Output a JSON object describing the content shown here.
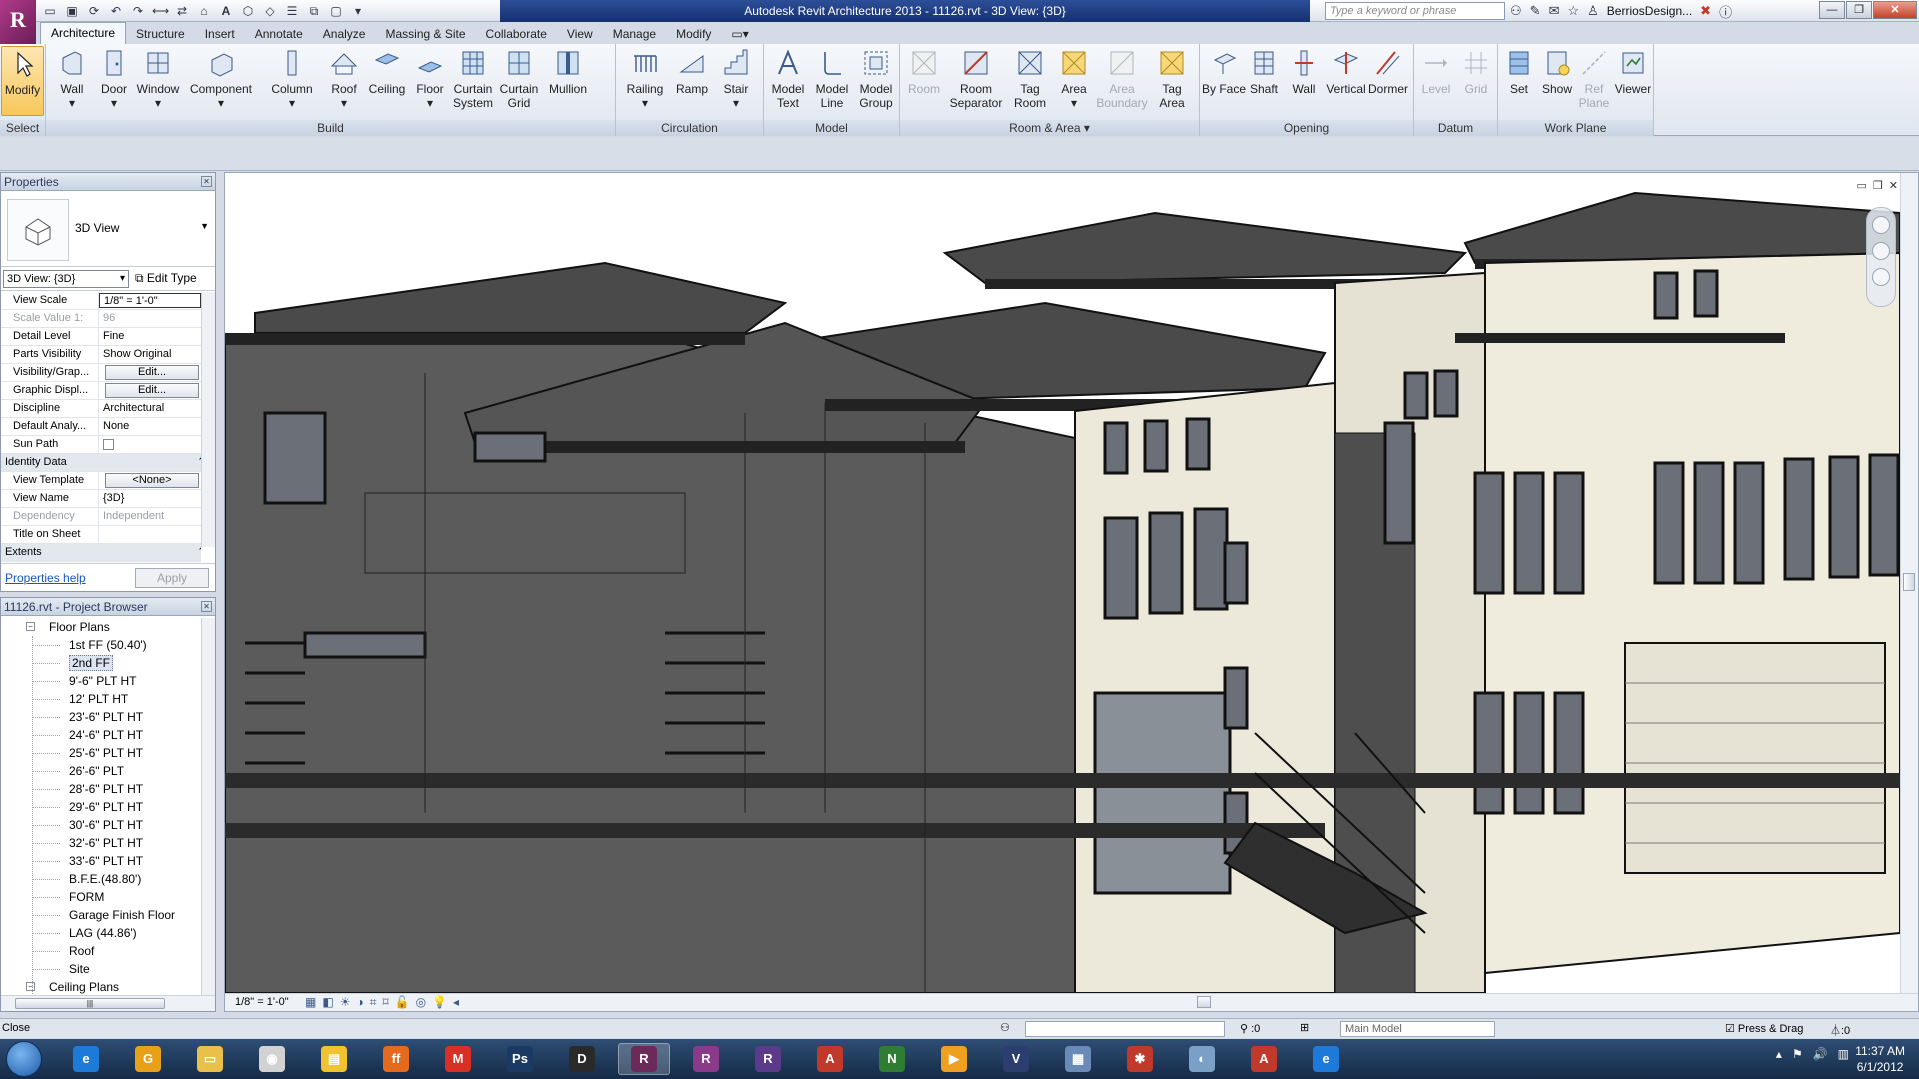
{
  "title_bar": {
    "title": "Autodesk Revit Architecture 2013  -  11126.rvt - 3D View: {3D}",
    "search_placeholder": "Type a keyword or phrase",
    "user": "BerriosDesign..."
  },
  "ribbon": {
    "tabs": [
      "Architecture",
      "Structure",
      "Insert",
      "Annotate",
      "Analyze",
      "Massing & Site",
      "Collaborate",
      "View",
      "Manage",
      "Modify"
    ],
    "groups": {
      "select": "Select",
      "build": "Build",
      "circulation": "Circulation",
      "model": "Model",
      "room_area": "Room & Area",
      "opening": "Opening",
      "datum": "Datum",
      "work_plane": "Work Plane"
    },
    "buttons": {
      "modify": "Modify",
      "wall": "Wall",
      "door": "Door",
      "window": "Window",
      "component": "Component",
      "column": "Column",
      "roof": "Roof",
      "ceiling": "Ceiling",
      "floor": "Floor",
      "curtain_system": "Curtain System",
      "curtain_grid": "Curtain Grid",
      "mullion": "Mullion",
      "railing": "Railing",
      "ramp": "Ramp",
      "stair": "Stair",
      "model_text": "Model Text",
      "model_line": "Model Line",
      "model_group": "Model Group",
      "room": "Room",
      "room_separator": "Room Separator",
      "tag_room": "Tag Room",
      "area": "Area",
      "area_boundary": "Area Boundary",
      "tag_area": "Tag Area",
      "by_face": "By Face",
      "shaft": "Shaft",
      "opening_wall": "Wall",
      "vertical": "Vertical",
      "dormer": "Dormer",
      "level": "Level",
      "grid": "Grid",
      "set": "Set",
      "show": "Show",
      "ref_plane": "Ref Plane",
      "viewer": "Viewer"
    }
  },
  "properties": {
    "title": "Properties",
    "type_name": "3D View",
    "instance_filter": "3D View: {3D}",
    "edit_type": "Edit Type",
    "rows": [
      {
        "name": "View Scale",
        "value": "1/8\" = 1'-0\""
      },
      {
        "name": "Scale Value    1:",
        "value": "96"
      },
      {
        "name": "Detail Level",
        "value": "Fine"
      },
      {
        "name": "Parts Visibility",
        "value": "Show Original"
      },
      {
        "name": "Visibility/Grap...",
        "value": "Edit..."
      },
      {
        "name": "Graphic Displ...",
        "value": "Edit..."
      },
      {
        "name": "Discipline",
        "value": "Architectural"
      },
      {
        "name": "Default Analy...",
        "value": "None"
      },
      {
        "name": "Sun Path",
        "value": ""
      },
      {
        "name": "Identity Data",
        "value": ""
      },
      {
        "name": "View Template",
        "value": "<None>"
      },
      {
        "name": "View Name",
        "value": "{3D}"
      },
      {
        "name": "Dependency",
        "value": "Independent"
      },
      {
        "name": "Title on Sheet",
        "value": ""
      },
      {
        "name": "Extents",
        "value": ""
      }
    ],
    "help": "Properties help",
    "apply": "Apply"
  },
  "browser": {
    "title": "11126.rvt - Project Browser",
    "floor_plans": "Floor Plans",
    "items": [
      "1st FF (50.40')",
      "2nd FF",
      "9'-6\" PLT HT",
      "12' PLT HT",
      "23'-6\" PLT HT",
      "24'-6\" PLT HT",
      "25'-6\" PLT HT",
      "26'-6\" PLT",
      "28'-6\" PLT HT",
      "29'-6\" PLT HT",
      "30'-6\" PLT HT",
      "32'-6\" PLT HT",
      "33'-6\" PLT HT",
      "B.F.E.(48.80')",
      "FORM",
      "Garage Finish Floor",
      "LAG (44.86')",
      "Roof",
      "Site"
    ],
    "ceiling_plans": "Ceiling Plans"
  },
  "view": {
    "scale": "1/8\" = 1'-0\""
  },
  "status": {
    "text": "Close",
    "count": ":0",
    "model": "Main Model",
    "press_drag": "Press & Drag",
    "filter_count": ":0"
  },
  "taskbar": {
    "time": "11:37 AM",
    "date": "6/1/2012",
    "apps": [
      {
        "label": "e",
        "color": "#1e7ad8"
      },
      {
        "label": "G",
        "color": "#e8a018"
      },
      {
        "label": "▭",
        "color": "#e9c14a"
      },
      {
        "label": "◉",
        "color": "#d2d2d2"
      },
      {
        "label": "▤",
        "color": "#f1c232"
      },
      {
        "label": "ff",
        "color": "#e66a1e"
      },
      {
        "label": "M",
        "color": "#d93025"
      },
      {
        "label": "Ps",
        "color": "#1b3a63"
      },
      {
        "label": "D",
        "color": "#2a2a2a"
      },
      {
        "label": "R",
        "color": "#6b2a5a"
      },
      {
        "label": "R",
        "color": "#8a3a8a"
      },
      {
        "label": "R",
        "color": "#5b3a8a"
      },
      {
        "label": "A",
        "color": "#c0392b"
      },
      {
        "label": "N",
        "color": "#2e7d32"
      },
      {
        "label": "▶",
        "color": "#f0a020"
      },
      {
        "label": "V",
        "color": "#2c3e70"
      },
      {
        "label": "▦",
        "color": "#6a8ab8"
      },
      {
        "label": "✱",
        "color": "#c0392b"
      },
      {
        "label": "◐",
        "color": "#7aa0c8"
      },
      {
        "label": "A",
        "color": "#c0392b"
      },
      {
        "label": "e",
        "color": "#1e7ad8"
      }
    ]
  }
}
